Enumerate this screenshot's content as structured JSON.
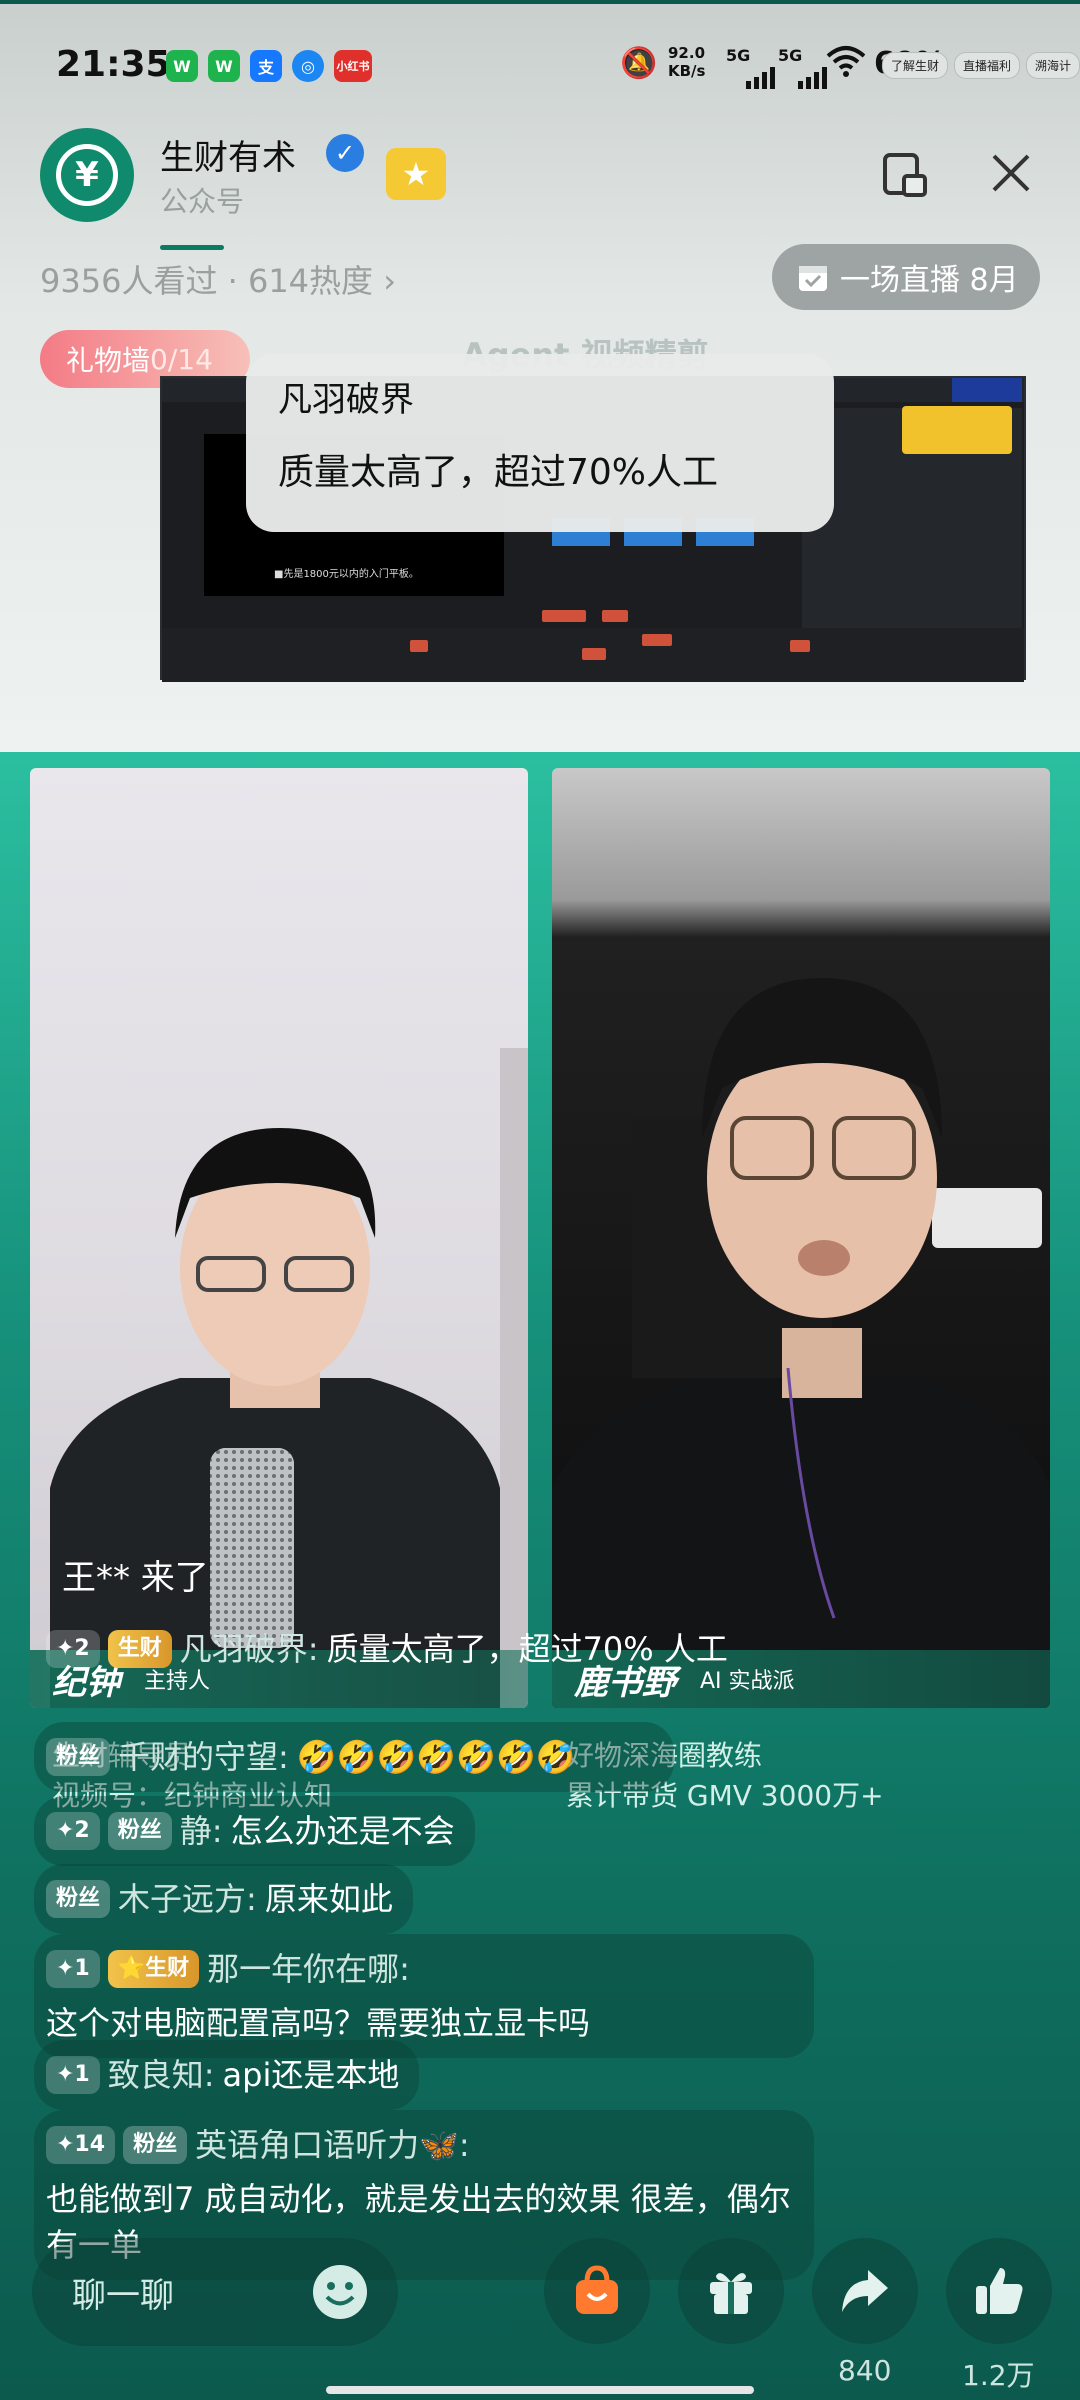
{
  "status_bar": {
    "time": "21:35",
    "network_speed": "92.0\nKB/s",
    "signal1": "5G",
    "signal2": "5G",
    "battery": "69%",
    "mini_pills": [
      "了解生财",
      "直播福利",
      "溯海计"
    ]
  },
  "header": {
    "account_name": "生财有术",
    "account_type": "公众号",
    "viewers": "9356人看过 · 614热度 ›",
    "next_live": "一场直播 8月",
    "gift_wall_label": "礼物墙 ",
    "gift_wall_count": "0/14",
    "overlay_title": "Agent 视频精剪"
  },
  "screen_share": {
    "preview_caption": "■先是1800元以内的入门平板。"
  },
  "pinned_bubble": {
    "user": "凡羽破界",
    "message": "质量太高了，超过70%人工"
  },
  "hosts": {
    "left": {
      "name": "纪钟",
      "role": "主持人",
      "caption_line1": "生财辅导员",
      "caption_line2": "视频号：纪钟商业认知"
    },
    "right": {
      "name": "鹿书野",
      "role": "AI 实战派",
      "caption_line1": "好物深海圈教练",
      "caption_line2": "累计带货 GMV 3000万+"
    }
  },
  "arrival": "王** 来了",
  "comments": [
    {
      "level": "✦2",
      "badge": "生财",
      "user": "凡羽破界:",
      "text": "质量太高了，超过70% 人工"
    },
    {
      "level": "",
      "badge": "粉丝",
      "user": "千财的守望:",
      "text": "🤣🤣🤣🤣🤣🤣🤣"
    },
    {
      "level": "✦2",
      "badge": "粉丝",
      "user": "静:",
      "text": "怎么办还是不会"
    },
    {
      "level": "",
      "badge": "粉丝",
      "user": "木子远方:",
      "text": "原来如此"
    },
    {
      "level": "✦1",
      "badge": "⭐生财",
      "user": "那一年你在哪:",
      "text": "这个对电脑配置高吗？需要独立显卡吗"
    },
    {
      "level": "✦1",
      "badge": "",
      "user": "致良知:",
      "text": "api还是本地"
    },
    {
      "level": "✦14",
      "badge": "粉丝",
      "user": "英语角口语听力🦋:",
      "text": "也能做到7 成自动化，就是发出去的效果 很差，偶尔有一单"
    }
  ],
  "bottom_bar": {
    "chat_placeholder": "聊一聊",
    "share_count": "840",
    "like_count": "1.2万"
  },
  "colors": {
    "brand_green": "#0f8a6c",
    "live_bg_top": "#2bbfa0",
    "live_bg_bottom": "#0c5a4e",
    "gift_pink": "#f47b86",
    "shop_orange": "#ff7a2f"
  }
}
